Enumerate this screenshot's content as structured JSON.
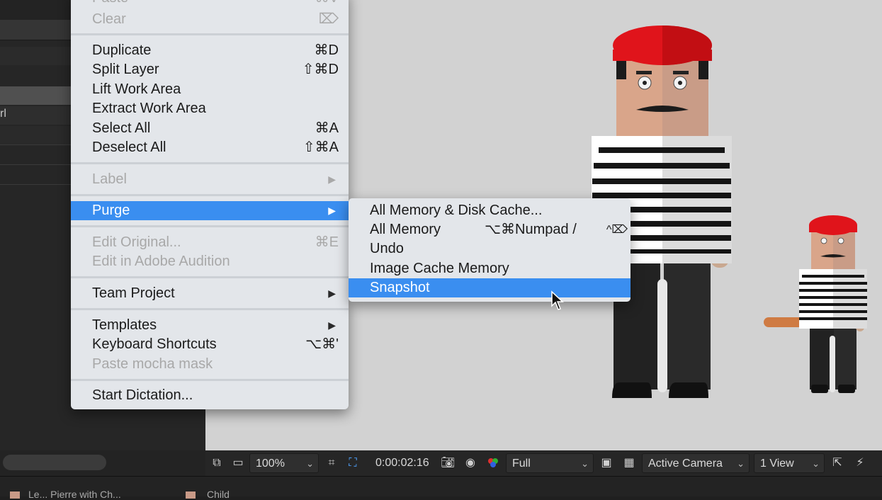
{
  "edit_menu": {
    "items": [
      {
        "label": "Paste",
        "shortcut": "⌘V",
        "disabled": true
      },
      {
        "label": "Clear",
        "shortcut": "⌦",
        "disabled": true
      },
      {
        "label": "Duplicate",
        "shortcut": "⌘D"
      },
      {
        "label": "Split Layer",
        "shortcut": "⇧⌘D"
      },
      {
        "label": "Lift Work Area",
        "shortcut": ""
      },
      {
        "label": "Extract Work Area",
        "shortcut": ""
      },
      {
        "label": "Select All",
        "shortcut": "⌘A"
      },
      {
        "label": "Deselect All",
        "shortcut": "⇧⌘A"
      },
      {
        "label": "Label",
        "disabled": true,
        "submenu": true
      },
      {
        "label": "Purge",
        "highlighted": true,
        "submenu": true
      },
      {
        "label": "Edit Original...",
        "shortcut": "⌘E",
        "disabled": true
      },
      {
        "label": "Edit in Adobe Audition",
        "disabled": true
      },
      {
        "label": "Team Project",
        "submenu": true
      },
      {
        "label": "Templates",
        "submenu": true
      },
      {
        "label": "Keyboard Shortcuts",
        "shortcut": "⌥⌘'"
      },
      {
        "label": "Paste mocha mask",
        "disabled": true
      },
      {
        "label": "Start Dictation...",
        "shortcut": ""
      }
    ],
    "submenu_arrow": "▶"
  },
  "purge_menu": {
    "items": [
      {
        "label": "All Memory & Disk Cache...",
        "shortcut": ""
      },
      {
        "label": "All Memory",
        "shortcut": "⌥⌘Numpad /",
        "shortcut2": "^⌦"
      },
      {
        "label": "Undo",
        "shortcut": ""
      },
      {
        "label": "Image Cache Memory",
        "shortcut": ""
      },
      {
        "label": "Snapshot",
        "highlighted": true
      }
    ]
  },
  "left_panel": {
    "partial_text": "rl"
  },
  "viewer_toolbar": {
    "magnification": "100%",
    "timecode": "0:00:02:16",
    "resolution": "Full",
    "camera": "Active Camera",
    "views": "1 View",
    "icons": [
      "always-preview-icon",
      "monitor-icon",
      "grid-icon",
      "region-of-interest-icon",
      "camera-snapshot-icon",
      "show-snapshot-icon",
      "color-channel-icon",
      "toggle-transparency-icon",
      "checkerboard-icon",
      "reset-exposure-icon",
      "fast-previews-icon"
    ]
  },
  "bottom_tabs": [
    {
      "label": "Le... Pierre with Ch..."
    },
    {
      "label": "Child"
    }
  ],
  "colors": {
    "menu_bg": "#e3e6ea",
    "highlight": "#3a8ef0",
    "viewer_bg": "#d2d2d2",
    "panel_bg": "#262626",
    "beret_red": "#e0141b"
  }
}
